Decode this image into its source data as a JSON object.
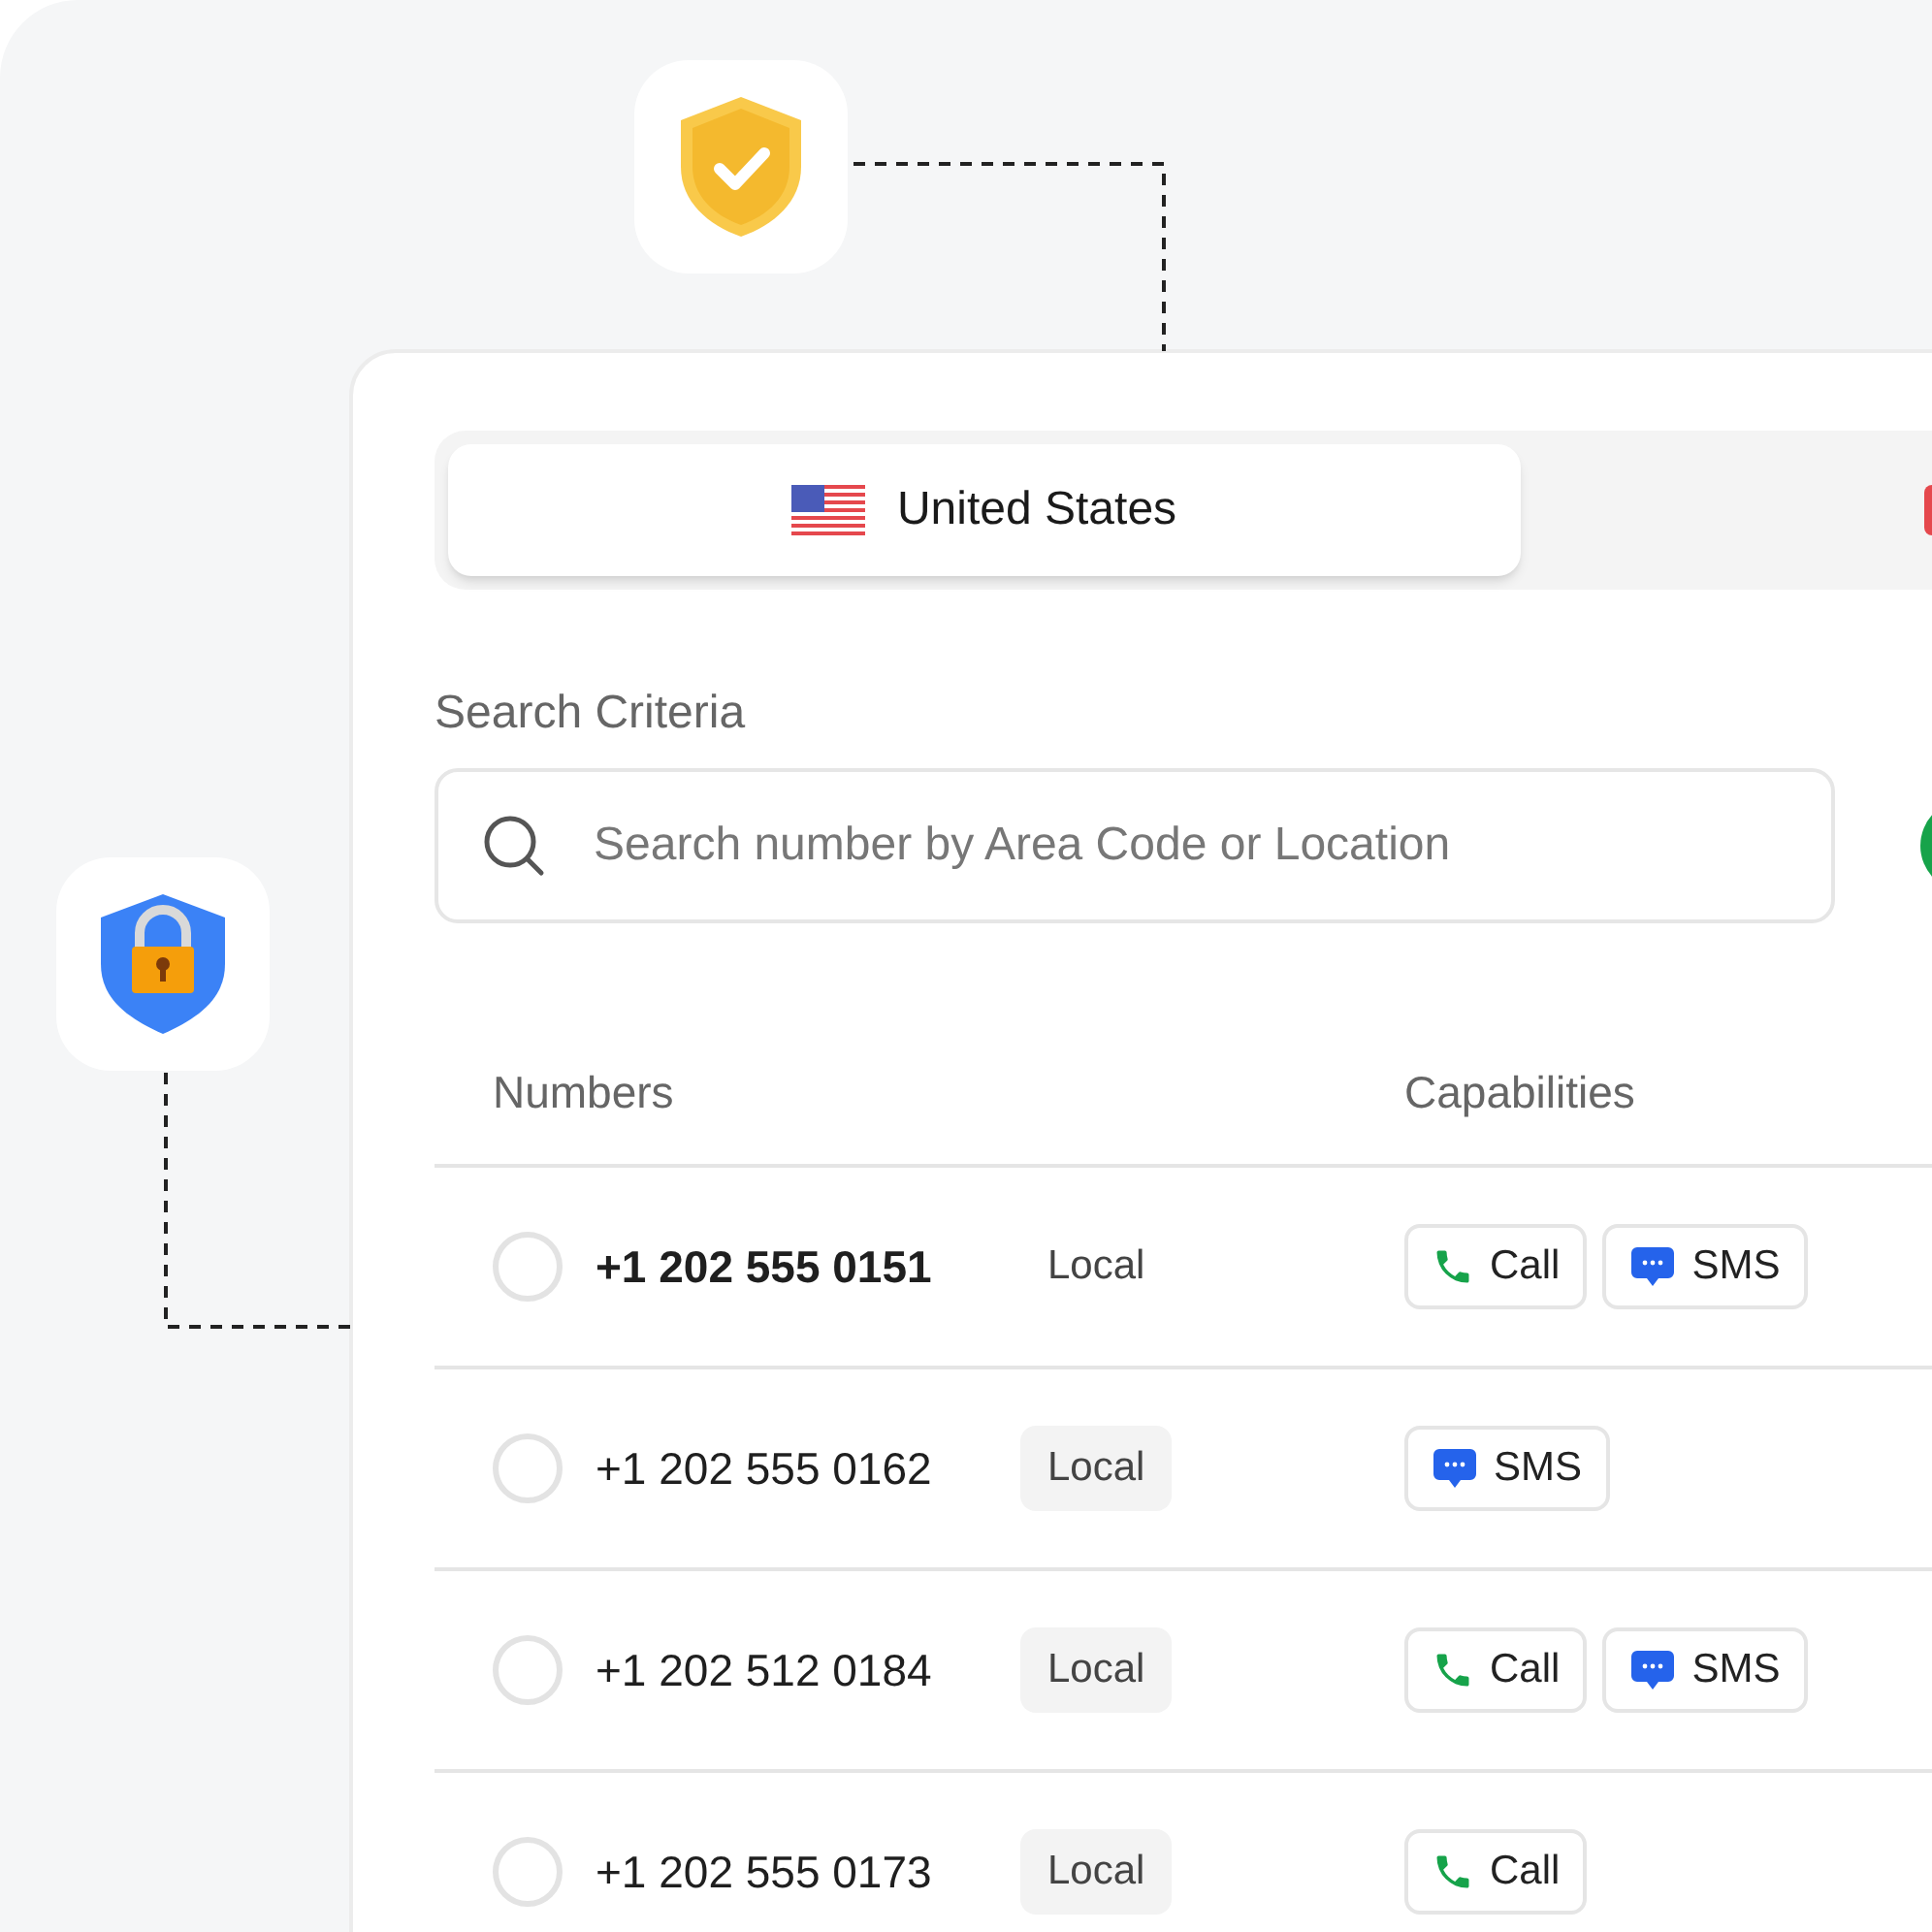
{
  "tabs": [
    {
      "label": "United States",
      "selected": true
    },
    {
      "selected": false
    }
  ],
  "search": {
    "label": "Search Criteria",
    "placeholder": "Search number by Area Code or Location"
  },
  "table": {
    "columns": [
      "Numbers",
      "Capabilities"
    ],
    "rows": [
      {
        "number": "+1 202 555 0151",
        "type": "Local",
        "highlighted": true,
        "selected": false,
        "capabilities": [
          {
            "kind": "call",
            "label": "Call"
          },
          {
            "kind": "sms",
            "label": "SMS"
          }
        ]
      },
      {
        "number": "+1 202 555 0162",
        "type": "Local",
        "highlighted": false,
        "selected": false,
        "capabilities": [
          {
            "kind": "sms",
            "label": "SMS"
          }
        ]
      },
      {
        "number": "+1 202 512 0184",
        "type": "Local",
        "highlighted": false,
        "selected": false,
        "capabilities": [
          {
            "kind": "call",
            "label": "Call"
          },
          {
            "kind": "sms",
            "label": "SMS"
          }
        ]
      },
      {
        "number": "+1 202 555 0173",
        "type": "Local",
        "highlighted": false,
        "selected": false,
        "capabilities": [
          {
            "kind": "call",
            "label": "Call"
          }
        ]
      }
    ]
  }
}
